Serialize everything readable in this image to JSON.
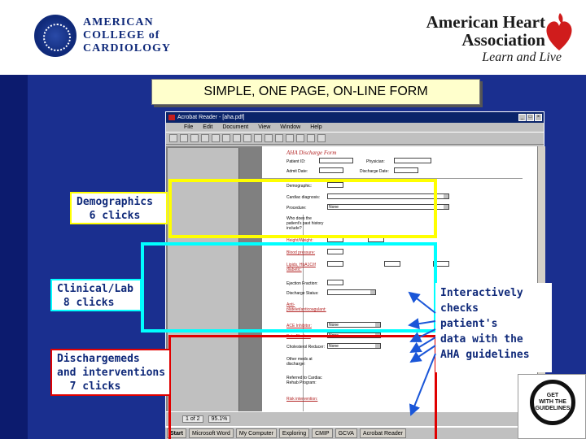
{
  "slide": {
    "title": "SIMPLE, ONE PAGE, ON-LINE FORM",
    "acc_name": "AMERICAN\nCOLLEGE of\nCARDIOLOGY",
    "aha_name": "American Heart\nAssociation",
    "aha_tagline": "Learn and Live",
    "gwtg_logo": "GET\nWITH THE\nGUIDELINES",
    "colors": {
      "background": "#1a2f8f",
      "highlight_demographics": "#ffff00",
      "highlight_clinical": "#00ffff",
      "highlight_discharge": "#e00000",
      "label_text": "#102a7a"
    }
  },
  "callouts": {
    "demographics": "Demographics\n  6 clicks",
    "clinical_lab": "Clinical/Lab\n 8 clicks",
    "discharge": "Dischargemeds\nand interventions\n  7 clicks",
    "interactive": "Interactively\nchecks\npatient's\ndata with the\nAHA guidelines"
  },
  "app": {
    "window_title": "Acrobat Reader - [aha.pdf]",
    "menu": [
      "File",
      "Edit",
      "Document",
      "View",
      "Window",
      "Help"
    ],
    "page_indicator": "1 of 2",
    "zoom": "95.1%",
    "form_title": "AHA Discharge Form",
    "fields": {
      "patient_id": "Patient ID:",
      "physician": "Physician:",
      "admit_date": "Admit Date:",
      "discharge_date": "Discharge Date:",
      "demographic": "Demographic:",
      "cardiac_diagnosis": "Cardiac diagnosis:",
      "procedure": "Procedure:",
      "history_question": "Who does the patient's past history include?",
      "height_weight": "Height/Weight:",
      "blood_pressure": "Blood pressure:",
      "lipids": "Lipids, HbA1C/if diabetic:",
      "ejection_fraction": "Ejection Fraction:",
      "discharge_status": "Discharge Status:",
      "anti_platelet": "Anti-platelet/anticoagulant:",
      "ace_inhibitor": "ACE Inhibitor:",
      "beta_blocker": "Beta Blocker:",
      "cholesterol_reducer": "Cholesterol Reducer:",
      "other_meds": "Other meds at discharge:",
      "cardiac_rehab": "Referred to Cardiac Rehab Program:",
      "risk_intervention": "Risk intervention:"
    },
    "dropdown_none": "None"
  },
  "taskbar": {
    "start": "Start",
    "items": [
      "Microsoft Word",
      "My Computer",
      "Exploring",
      "CMIP",
      "GCVA",
      "Acrobat Reader"
    ]
  }
}
